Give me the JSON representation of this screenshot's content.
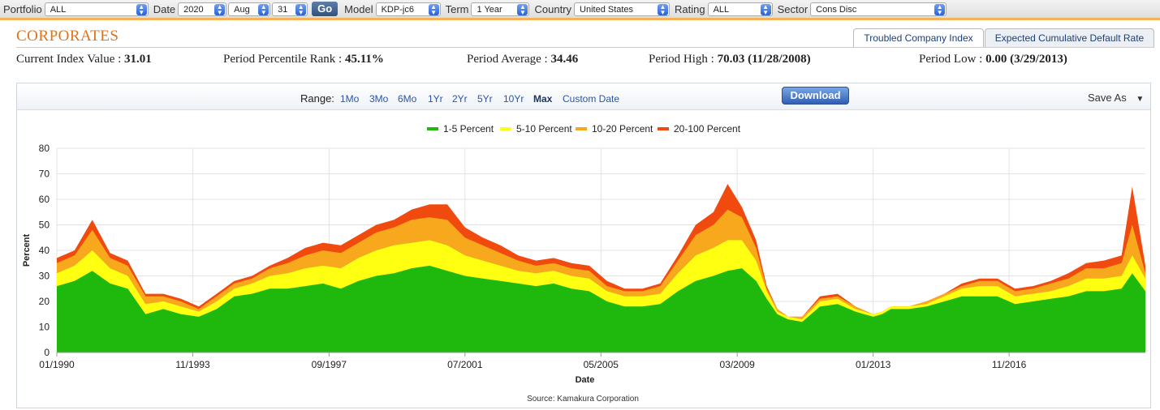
{
  "filters": [
    {
      "label": "Portfolio",
      "value": "ALL",
      "width": 128
    },
    {
      "label": "Date",
      "value": "2020",
      "width": 60
    },
    {
      "label": "",
      "value": "Aug",
      "width": 52
    },
    {
      "label": "",
      "value": "31",
      "width": 44
    },
    {
      "label": "Model",
      "value": "KDP-jc6",
      "width": 80
    },
    {
      "label": "Term",
      "value": "1 Year",
      "width": 72
    },
    {
      "label": "Country",
      "value": "United States",
      "width": 118
    },
    {
      "label": "Rating",
      "value": "ALL",
      "width": 80
    },
    {
      "label": "Sector",
      "value": "Cons Disc",
      "width": 168
    }
  ],
  "go_label": "Go",
  "page_title": "CORPORATES",
  "tabs": {
    "active": "Troubled Company Index",
    "inactive": "Expected Cumulative Default Rate"
  },
  "stats": [
    {
      "label": "Current Index Value : ",
      "value": "31.01"
    },
    {
      "label": "Period Percentile Rank : ",
      "value": "45.11%"
    },
    {
      "label": "Period Average : ",
      "value": "34.46"
    },
    {
      "label": "Period High : ",
      "value": "70.03 (11/28/2008)"
    },
    {
      "label": "Period Low : ",
      "value": "0.00 (3/29/2013)"
    }
  ],
  "toolbar": {
    "range_label": "Range:",
    "ranges": [
      "1Mo",
      "3Mo",
      "6Mo",
      "1Yr",
      "2Yr",
      "5Yr",
      "10Yr",
      "Max",
      "Custom Date"
    ],
    "selected_range": "Max",
    "download_label": "Download",
    "save_as_label": "Save As"
  },
  "colors": {
    "accent": "#e0731a",
    "s1": "#1fb80d",
    "s2": "#ffff11",
    "s3": "#f7a81c",
    "s4": "#f04a0e"
  },
  "chart_data": {
    "type": "area",
    "stacked": true,
    "xlabel": "Date",
    "ylabel": "Percent",
    "ylim": [
      0,
      80
    ],
    "yticks": [
      0,
      10,
      20,
      30,
      40,
      50,
      60,
      70,
      80
    ],
    "xtick_labels": [
      "01/1990",
      "11/1993",
      "09/1997",
      "07/2001",
      "05/2005",
      "03/2009",
      "01/2013",
      "11/2016"
    ],
    "xtick_years": [
      1990.0,
      1993.83,
      1997.67,
      2001.5,
      2005.33,
      2009.17,
      2013.0,
      2016.83
    ],
    "xlim": [
      1990.0,
      2020.67
    ],
    "grid": true,
    "legend_position": "top-center",
    "source": "Source: Kamakura Corporation",
    "x": [
      1990.0,
      1990.5,
      1991.0,
      1991.5,
      1992.0,
      1992.5,
      1993.0,
      1993.5,
      1994.0,
      1994.5,
      1995.0,
      1995.5,
      1996.0,
      1996.5,
      1997.0,
      1997.5,
      1998.0,
      1998.5,
      1999.0,
      1999.5,
      2000.0,
      2000.5,
      2001.0,
      2001.5,
      2002.0,
      2002.5,
      2003.0,
      2003.5,
      2004.0,
      2004.5,
      2005.0,
      2005.5,
      2006.0,
      2006.5,
      2007.0,
      2007.5,
      2008.0,
      2008.5,
      2008.9,
      2009.3,
      2009.7,
      2010.0,
      2010.3,
      2010.6,
      2011.0,
      2011.5,
      2012.0,
      2012.5,
      2013.0,
      2013.25,
      2013.5,
      2014.0,
      2014.5,
      2015.0,
      2015.5,
      2016.0,
      2016.5,
      2017.0,
      2017.5,
      2018.0,
      2018.5,
      2019.0,
      2019.5,
      2020.0,
      2020.3,
      2020.67
    ],
    "series": [
      {
        "name": "1-5 Percent",
        "values": [
          26,
          28,
          32,
          27,
          25,
          15,
          17,
          15,
          14,
          17,
          22,
          23,
          25,
          25,
          26,
          27,
          25,
          28,
          30,
          31,
          33,
          34,
          32,
          30,
          29,
          28,
          27,
          26,
          27,
          25,
          24,
          20,
          18,
          18,
          19,
          24,
          28,
          30,
          32,
          33,
          28,
          21,
          15,
          13,
          12,
          18,
          19,
          16,
          14,
          15,
          17,
          17,
          18,
          20,
          22,
          22,
          22,
          19,
          20,
          21,
          22,
          24,
          24,
          25,
          31,
          24
        ]
      },
      {
        "name": "5-10 Percent",
        "values": [
          5,
          6,
          8,
          6,
          5,
          4,
          3,
          3,
          2,
          3,
          3,
          4,
          5,
          6,
          7,
          7,
          8,
          9,
          10,
          11,
          10,
          10,
          10,
          8,
          7,
          6,
          5,
          5,
          5,
          5,
          5,
          4,
          4,
          4,
          4,
          7,
          10,
          11,
          12,
          11,
          8,
          3,
          1,
          1,
          1,
          2,
          2,
          1,
          1,
          1,
          1,
          1,
          1,
          2,
          3,
          4,
          4,
          3,
          3,
          3,
          4,
          5,
          5,
          5,
          7,
          5
        ]
      },
      {
        "name": "10-20 Percent",
        "values": [
          4,
          4,
          8,
          4,
          4,
          3,
          2,
          2,
          1,
          2,
          2,
          2,
          3,
          4,
          5,
          6,
          6,
          6,
          7,
          7,
          9,
          9,
          10,
          7,
          6,
          5,
          4,
          3,
          3,
          3,
          3,
          2,
          2,
          2,
          3,
          5,
          8,
          9,
          12,
          9,
          5,
          1,
          1,
          0,
          1,
          1,
          1,
          1,
          0,
          0,
          0,
          0,
          1,
          1,
          1,
          2,
          2,
          2,
          2,
          3,
          3,
          4,
          4,
          5,
          12,
          2
        ]
      },
      {
        "name": "20-100 Percent",
        "values": [
          2,
          2,
          4,
          2,
          2,
          1,
          1,
          1,
          1,
          1,
          1,
          1,
          1,
          2,
          3,
          3,
          3,
          3,
          3,
          3,
          4,
          5,
          6,
          4,
          3,
          3,
          2,
          2,
          2,
          2,
          2,
          2,
          1,
          1,
          1,
          2,
          4,
          5,
          10,
          4,
          3,
          1,
          0,
          0,
          0,
          1,
          1,
          0,
          0,
          0,
          0,
          0,
          0,
          0,
          1,
          1,
          1,
          1,
          1,
          1,
          2,
          2,
          3,
          3,
          15,
          3
        ]
      }
    ]
  }
}
